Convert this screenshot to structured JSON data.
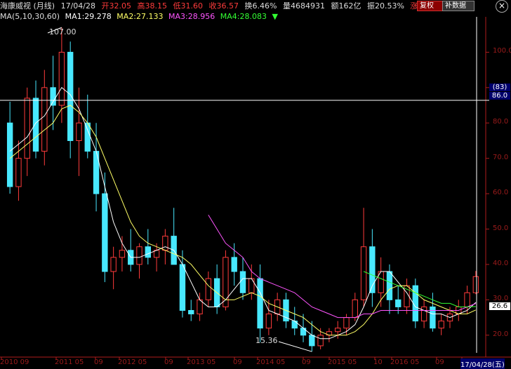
{
  "header": {
    "name": "海康威视 (月线)",
    "date": "17/04/28",
    "open": "开32.05",
    "high": "高38.15",
    "low": "低31.60",
    "close": "收36.57",
    "turnover": "换6.46%",
    "volume": "量4684931",
    "amount": "额162亿",
    "amplitude": "振20.53%",
    "rise": "涨(",
    "reset_label": "复权",
    "data_label": "补数据"
  },
  "indicators": {
    "ma_params": "MA(5,10,30,60)",
    "ma1": "MA1:29.278",
    "ma2": "MA2:27.133",
    "ma3": "MA3:28.956",
    "ma4": "MA4:28.083"
  },
  "annotations": {
    "max_label": "107.00",
    "min_label": "15.36",
    "crosshair_count": "(83)",
    "crosshair_price": "86.0",
    "last_price": "26.6"
  },
  "y_labels": [
    "100.0",
    "90.0",
    "80.0",
    "70.0",
    "60.0",
    "50.0",
    "40.0",
    "30.0",
    "20.0"
  ],
  "x_labels": [
    "2010 09",
    "2011 05",
    "09",
    "2012 05",
    "09",
    "2013 05",
    "09",
    "2014 05",
    "09",
    "2015 05",
    "10",
    "2016 05",
    "09",
    "17/04/28(五)"
  ],
  "colors": {
    "up": "#ff3b3b",
    "down": "#48e8ff",
    "ma1": "#ffffff",
    "ma2": "#ffff66",
    "ma3": "#ff55ff",
    "ma4": "#33ff33",
    "axis": "#b01c1c",
    "price_label_up": "#ff3b3b",
    "price_label_down": "#1ee81e"
  },
  "chart_data": {
    "type": "candlestick",
    "ylim": [
      15,
      110
    ],
    "candles": [
      [
        80,
        86,
        60,
        62
      ],
      [
        62,
        75,
        58,
        70
      ],
      [
        70,
        90,
        65,
        87
      ],
      [
        87,
        92,
        70,
        72
      ],
      [
        72,
        95,
        68,
        90
      ],
      [
        90,
        99,
        78,
        85
      ],
      [
        85,
        107,
        80,
        100
      ],
      [
        100,
        103,
        70,
        75
      ],
      [
        75,
        90,
        65,
        80
      ],
      [
        80,
        88,
        70,
        72
      ],
      [
        72,
        80,
        55,
        60
      ],
      [
        60,
        66,
        35,
        38
      ],
      [
        38,
        45,
        33,
        42
      ],
      [
        42,
        48,
        38,
        44
      ],
      [
        44,
        50,
        38,
        40
      ],
      [
        40,
        46,
        36,
        45
      ],
      [
        45,
        50,
        40,
        42
      ],
      [
        42,
        46,
        38,
        44
      ],
      [
        44,
        50,
        40,
        48
      ],
      [
        48,
        56,
        44,
        40
      ],
      [
        40,
        44,
        25,
        27
      ],
      [
        27,
        30,
        24,
        26
      ],
      [
        26,
        32,
        24,
        30
      ],
      [
        30,
        38,
        28,
        36
      ],
      [
        36,
        40,
        26,
        28
      ],
      [
        28,
        44,
        27,
        42
      ],
      [
        42,
        46,
        34,
        38
      ],
      [
        38,
        42,
        30,
        32
      ],
      [
        32,
        40,
        30,
        36
      ],
      [
        36,
        40,
        18,
        22
      ],
      [
        22,
        30,
        20,
        26
      ],
      [
        26,
        32,
        24,
        30
      ],
      [
        30,
        32,
        22,
        24
      ],
      [
        24,
        28,
        20,
        22
      ],
      [
        22,
        26,
        18,
        20
      ],
      [
        20,
        24,
        15.36,
        17
      ],
      [
        17,
        22,
        16,
        20
      ],
      [
        20,
        22,
        18,
        21
      ],
      [
        21,
        24,
        19,
        22
      ],
      [
        22,
        26,
        20,
        25
      ],
      [
        25,
        32,
        24,
        30
      ],
      [
        30,
        56,
        28,
        45
      ],
      [
        45,
        50,
        28,
        32
      ],
      [
        32,
        42,
        28,
        38
      ],
      [
        38,
        40,
        26,
        30
      ],
      [
        30,
        34,
        26,
        28
      ],
      [
        28,
        36,
        26,
        34
      ],
      [
        34,
        36,
        22,
        24
      ],
      [
        24,
        30,
        22,
        28
      ],
      [
        28,
        32,
        21,
        22
      ],
      [
        22,
        26,
        20,
        24
      ],
      [
        24,
        28,
        22,
        26
      ],
      [
        26,
        30,
        24,
        28
      ],
      [
        28,
        34,
        26,
        32
      ],
      [
        32,
        38.15,
        31.6,
        36.57
      ]
    ],
    "ma1": [
      72,
      74,
      76,
      80,
      82,
      86,
      90,
      88,
      84,
      78,
      72,
      62,
      52,
      46,
      42,
      42,
      43,
      44,
      45,
      44,
      40,
      35,
      30,
      28,
      28,
      30,
      33,
      36,
      36,
      32,
      27,
      26,
      25,
      24,
      22,
      20,
      19,
      19,
      20,
      21,
      23,
      28,
      34,
      38,
      38,
      35,
      32,
      28,
      27,
      26,
      26,
      25,
      26,
      27,
      29.278
    ],
    "ma2": [
      70,
      72,
      74,
      76,
      78,
      80,
      84,
      85,
      83,
      80,
      76,
      70,
      64,
      58,
      52,
      48,
      46,
      45,
      44,
      43,
      42,
      40,
      37,
      34,
      32,
      30,
      30,
      31,
      32,
      31,
      29,
      28,
      27,
      26,
      25,
      23,
      21,
      20,
      20,
      20,
      21,
      23,
      26,
      30,
      33,
      34,
      34,
      32,
      30,
      29,
      28,
      27,
      26,
      26,
      27.133
    ],
    "ma3": [
      null,
      null,
      null,
      null,
      null,
      null,
      null,
      null,
      null,
      null,
      null,
      null,
      null,
      null,
      null,
      null,
      null,
      null,
      null,
      null,
      null,
      null,
      null,
      54,
      50,
      46,
      44,
      42,
      38,
      36,
      35,
      34,
      33,
      32,
      30,
      28,
      27,
      26,
      25,
      25,
      25,
      26,
      26,
      27,
      27,
      27,
      27,
      27,
      27,
      27,
      27,
      27,
      27,
      28,
      28.956
    ],
    "ma4": [
      null,
      null,
      null,
      null,
      null,
      null,
      null,
      null,
      null,
      null,
      null,
      null,
      null,
      null,
      null,
      null,
      null,
      null,
      null,
      null,
      null,
      null,
      null,
      null,
      null,
      null,
      null,
      null,
      null,
      null,
      null,
      null,
      null,
      null,
      null,
      null,
      null,
      null,
      null,
      null,
      null,
      38,
      37,
      36,
      35,
      34,
      33,
      32,
      31,
      30,
      29,
      29,
      28,
      28,
      28.083
    ]
  }
}
